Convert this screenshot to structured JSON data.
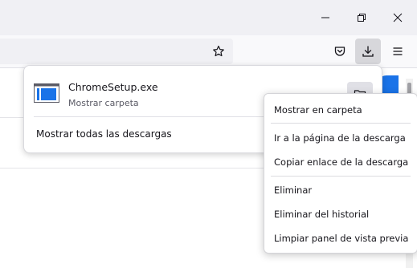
{
  "window": {
    "minimize_icon": "minimize-icon",
    "restore_icon": "restore-icon",
    "close_icon": "close-icon"
  },
  "toolbar": {
    "bookmark_icon": "star-icon",
    "pocket_icon": "pocket-icon",
    "downloads_icon": "download-icon",
    "menu_icon": "hamburger-menu-icon"
  },
  "downloads_panel": {
    "items": [
      {
        "file_name": "ChromeSetup.exe",
        "status": "Mostrar carpeta",
        "icon": "exe-file-icon",
        "action_icon": "folder-icon"
      }
    ],
    "show_all_label": "Mostrar todas las descargas"
  },
  "context_menu": {
    "items": [
      {
        "label": "Mostrar en carpeta"
      },
      {
        "label": "Ir a la página de la descarga"
      },
      {
        "label": "Copiar enlace de la descarga"
      },
      {
        "label": "Eliminar"
      },
      {
        "label": "Eliminar del historial"
      },
      {
        "label": "Limpiar panel de vista previa"
      }
    ]
  },
  "colors": {
    "accent_blue": "#1a73e8",
    "toolbar_bg": "#f9f9fb",
    "titlebar_bg": "#f0f0f4"
  }
}
